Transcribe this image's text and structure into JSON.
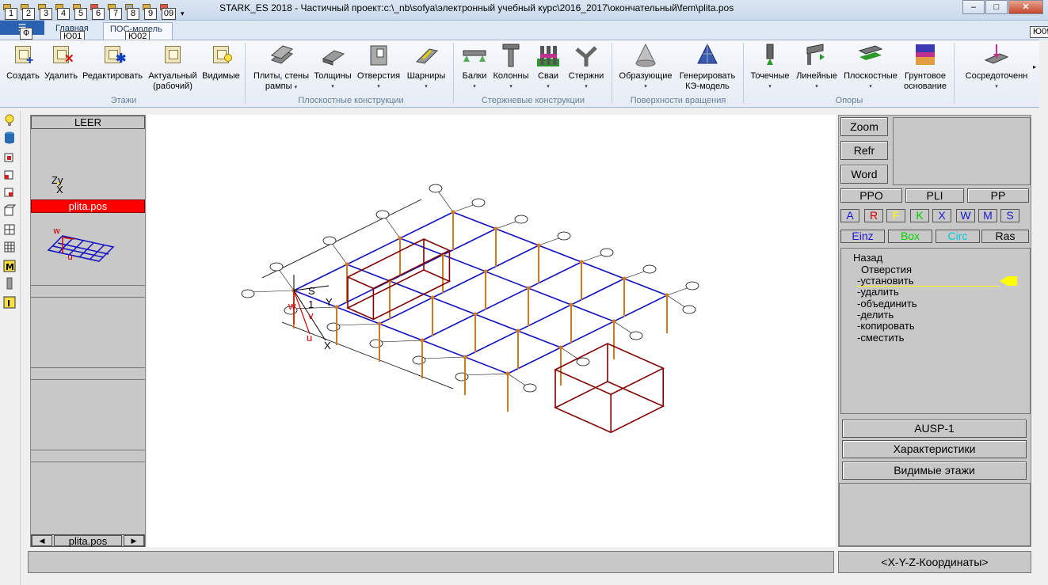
{
  "window": {
    "title": "STARK_ES 2018 - Частичный проект:c:\\_nb\\sofya\\электронный учебный курс\\2016_2017\\окончательный\\fem\\plita.pos",
    "btn_min": "–",
    "btn_max": "□",
    "btn_close": "✕"
  },
  "quick_access": {
    "keytips": [
      "1",
      "2",
      "3",
      "4",
      "5",
      "6",
      "7",
      "8",
      "9",
      "09"
    ]
  },
  "tabs": {
    "file_keytip": "Ф",
    "main": "Главная",
    "main_keytip": "Ю01",
    "pos_model": "ПОС-модель",
    "pos_keytip": "Ю02",
    "right_keytip": "Ю09"
  },
  "ribbon": {
    "etazhi": {
      "group": "Этажи",
      "create": "Создать",
      "delete": "Удалить",
      "edit": "Редактировать",
      "actual_1": "Актуальный",
      "actual_2": "(рабочий)",
      "visible": "Видимые"
    },
    "plane": {
      "group": "Плоскостные конструкции",
      "plates_1": "Плиты, стены",
      "plates_2": "рампы",
      "thickness": "Толщины",
      "openings": "Отверстия",
      "hinges": "Шарниры"
    },
    "rod": {
      "group": "Стержневые конструкции",
      "beams": "Балки",
      "columns": "Колонны",
      "piles": "Сваи",
      "rods": "Стержни"
    },
    "rotation": {
      "group": "Поверхности вращения",
      "generatrix": "Образующие",
      "generate_1": "Генерировать",
      "generate_2": "КЭ-модель"
    },
    "supports": {
      "group": "Опоры",
      "point": "Точечные",
      "linear": "Линейные",
      "plane": "Плоскостные",
      "soil_1": "Грунтовое",
      "soil_2": "основание",
      "concentrated": "Сосредоточенн"
    }
  },
  "left_panel": {
    "header": "LEER",
    "axes_z": "Zy",
    "axes_x": "X",
    "current_file": "plita.pos",
    "footer_file": "plita.pos",
    "prev": "◀",
    "next": "▶"
  },
  "canvas": {
    "label_s": "S",
    "label_y": "Y",
    "label_x": "X",
    "label_w": "w",
    "label_v": "v",
    "label_u": "u",
    "label_1": "1"
  },
  "right_panel": {
    "zoom": "Zoom",
    "refr": "Refr",
    "word": "Word",
    "ppo": "PPO",
    "pli": "PLI",
    "pp": "PP",
    "letters": [
      "A",
      "R",
      "F",
      "K",
      "X",
      "W",
      "M",
      "S"
    ],
    "letter_colors": [
      "#1a1acc",
      "#d00000",
      "#ffff00",
      "#00d000",
      "#1a1acc",
      "#1a1acc",
      "#1a1acc",
      "#1a1acc"
    ],
    "modes": [
      "Einz",
      "Box",
      "Circ",
      "Ras"
    ],
    "mode_colors": [
      "#1a1acc",
      "#00d000",
      "#00c8e0",
      "#000000"
    ],
    "menu": {
      "back": "Назад",
      "title": "Отверстия",
      "items": [
        "-установить",
        "-удалить",
        "-объединить",
        "-делить",
        "-копировать",
        "-сместить"
      ]
    },
    "ausp": "AUSP-1",
    "characteristics": "Характеристики",
    "visible_floors": "Видимые этажи",
    "coords": "<X-Y-Z-Координаты>"
  },
  "colors": {
    "beam": "#1010c0",
    "column": "#d2781e",
    "opening": "#800000",
    "selected_file": "#ff0000",
    "menu_arrow": "#ffff00"
  }
}
